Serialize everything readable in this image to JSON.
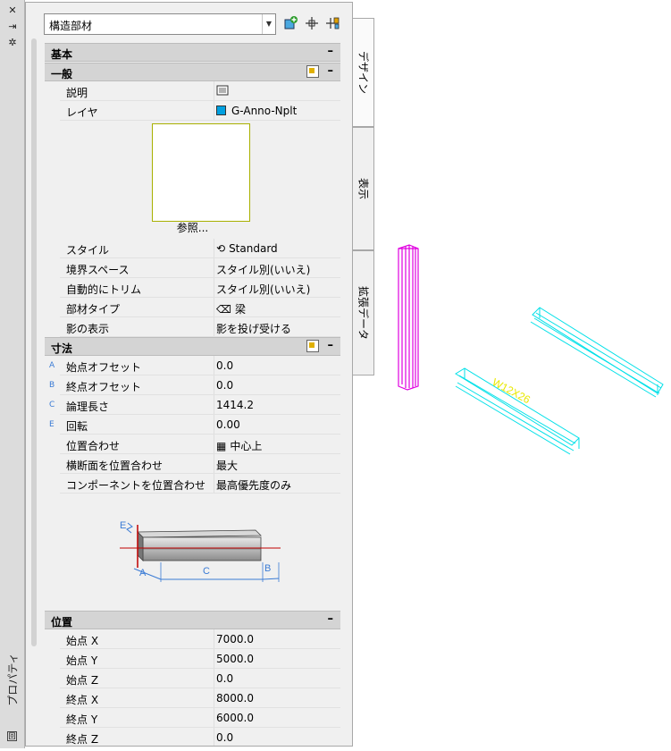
{
  "palette": {
    "title": "プロパティ",
    "style_value": "構造部材"
  },
  "tabs": [
    "デザイン",
    "表示",
    "拡張データ"
  ],
  "sections": {
    "basic": "基本",
    "general": "一般",
    "dimensions": "寸法",
    "location": "位置"
  },
  "general_rows": {
    "description": {
      "label": "説明",
      "value": ""
    },
    "layer": {
      "label": "レイヤ",
      "value": "G-Anno-Nplt",
      "swatch": "#00a0e0"
    }
  },
  "preview_label": "参照...",
  "general_rows2": {
    "style": {
      "label": "スタイル",
      "value": "Standard"
    },
    "boundary": {
      "label": "境界スペース",
      "value": "スタイル別(いいえ)"
    },
    "auto_trim": {
      "label": "自動的にトリム",
      "value": "スタイル別(いいえ)"
    },
    "member_type": {
      "label": "部材タイプ",
      "value": "梁"
    },
    "shadow": {
      "label": "影の表示",
      "value": "影を投げ受ける"
    }
  },
  "dim_rows": [
    {
      "prefix": "A",
      "label": "始点オフセット",
      "value": "0.0"
    },
    {
      "prefix": "B",
      "label": "終点オフセット",
      "value": "0.0"
    },
    {
      "prefix": "C",
      "label": "論理長さ",
      "value": "1414.2"
    },
    {
      "prefix": "E",
      "label": "回転",
      "value": "0.00"
    },
    {
      "prefix": "",
      "label": "位置合わせ",
      "value": "中心上"
    },
    {
      "prefix": "",
      "label": "横断面を位置合わせ",
      "value": "最大"
    },
    {
      "prefix": "",
      "label": "コンポーネントを位置合わせ",
      "value": "最高優先度のみ"
    }
  ],
  "diagram_labels": {
    "a": "A",
    "b": "B",
    "c": "C",
    "e": "E"
  },
  "location_rows": [
    {
      "label": "始点 X",
      "value": "7000.0"
    },
    {
      "label": "始点 Y",
      "value": "5000.0"
    },
    {
      "label": "始点 Z",
      "value": "0.0"
    },
    {
      "label": "終点 X",
      "value": "8000.0"
    },
    {
      "label": "終点 Y",
      "value": "6000.0"
    },
    {
      "label": "終点 Z",
      "value": "0.0"
    }
  ],
  "drawing": {
    "beam_tag": "W12X26",
    "colors": {
      "column": "#e000e0",
      "beam": "#00e0e8",
      "tag": "#e8e800"
    }
  }
}
